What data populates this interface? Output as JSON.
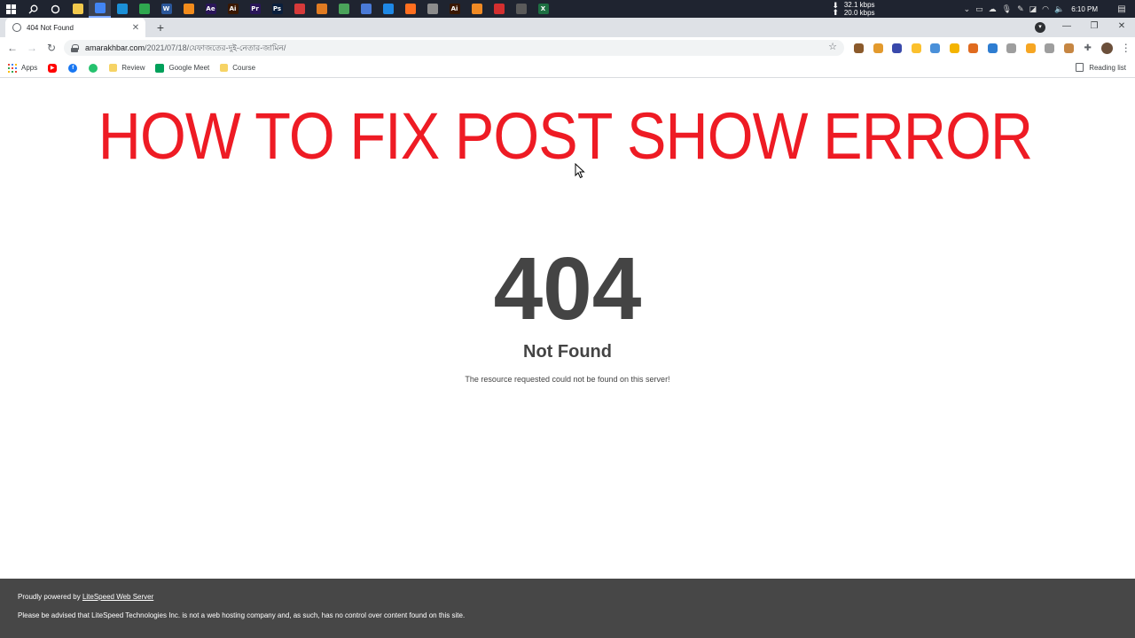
{
  "taskbar": {
    "apps": [
      {
        "name": "windows-start-icon",
        "color": "#ffffff",
        "glyph": ""
      },
      {
        "name": "search-icon",
        "color": "#1f2430",
        "glyph": ""
      },
      {
        "name": "cortana-icon",
        "color": "#1f2430",
        "glyph": ""
      },
      {
        "name": "file-explorer-icon",
        "color": "#f2c94c",
        "glyph": ""
      },
      {
        "name": "chrome-icon",
        "color": "#4285f4",
        "glyph": ""
      },
      {
        "name": "edge-icon",
        "color": "#1b8fd6",
        "glyph": ""
      },
      {
        "name": "camtasia-icon",
        "color": "#2fa84f",
        "glyph": ""
      },
      {
        "name": "word-icon",
        "color": "#2b579a",
        "glyph": "W"
      },
      {
        "name": "vlc-icon",
        "color": "#f28c1c",
        "glyph": ""
      },
      {
        "name": "after-effects-icon",
        "color": "#2a1659",
        "glyph": "Ae"
      },
      {
        "name": "illustrator-icon",
        "color": "#3a1800",
        "glyph": "Ai"
      },
      {
        "name": "premiere-icon",
        "color": "#2a1659",
        "glyph": "Pr"
      },
      {
        "name": "photoshop-icon",
        "color": "#0a1f3d",
        "glyph": "Ps"
      },
      {
        "name": "recorder-icon",
        "color": "#d63a3a",
        "glyph": ""
      },
      {
        "name": "sublime-icon",
        "color": "#e07b22",
        "glyph": ""
      },
      {
        "name": "chrome-alt-icon",
        "color": "#4aa35a",
        "glyph": ""
      },
      {
        "name": "store-icon",
        "color": "#4a7ad6",
        "glyph": ""
      },
      {
        "name": "vscode-icon",
        "color": "#1e88e5",
        "glyph": ""
      },
      {
        "name": "firefox-icon",
        "color": "#ff6f1f",
        "glyph": ""
      },
      {
        "name": "tool-icon",
        "color": "#8c8c8c",
        "glyph": ""
      },
      {
        "name": "illustrator-alt-icon",
        "color": "#3a1800",
        "glyph": "Ai"
      },
      {
        "name": "blender-icon",
        "color": "#f08a24",
        "glyph": ""
      },
      {
        "name": "opera-icon",
        "color": "#d32f2f",
        "glyph": ""
      },
      {
        "name": "obs-icon",
        "color": "#5a5a5a",
        "glyph": ""
      },
      {
        "name": "excel-icon",
        "color": "#1d6f42",
        "glyph": "X"
      }
    ],
    "net_up": "32.1 kbps",
    "net_down": "20.0 kbps",
    "clock": "6:10 PM"
  },
  "browser": {
    "tab_title": "404 Not Found",
    "url_host": "amarakhbar.com",
    "url_path": "/2021/07/18/যেফাজতের-দুই-নেতার-জামিন/",
    "bookmarks": [
      {
        "label": "Apps",
        "kind": "apps"
      },
      {
        "label": "",
        "kind": "youtube",
        "color": "#ff0000"
      },
      {
        "label": "",
        "kind": "facebook",
        "color": "#1877f2"
      },
      {
        "label": "",
        "kind": "green",
        "color": "#25c26e"
      },
      {
        "label": "Review",
        "kind": "folder",
        "color": "#f6d365"
      },
      {
        "label": "Google Meet",
        "kind": "meet",
        "color": "#00a05a"
      },
      {
        "label": "Course",
        "kind": "folder",
        "color": "#f6d365"
      }
    ],
    "reading_list": "Reading list",
    "extensions": [
      "#8b5a2b",
      "#e39a2d",
      "#3949ab",
      "#fbc02d",
      "#4a90d9",
      "#f4b400",
      "#e06b1f",
      "#2e7dd1",
      "#9e9e9e",
      "#f6a623",
      "#9e9e9e",
      "#c68642"
    ]
  },
  "page": {
    "overlay_title": "HOW TO FIX POST SHOW ERROR",
    "error_code": "404",
    "error_title": "Not Found",
    "error_desc": "The resource requested could not be found on this server!",
    "footer_powered": "Proudly powered by ",
    "footer_link": "LiteSpeed Web Server",
    "footer_notice": "Please be advised that LiteSpeed Technologies Inc. is not a web hosting company and, as such, has no control over content found on this site."
  }
}
